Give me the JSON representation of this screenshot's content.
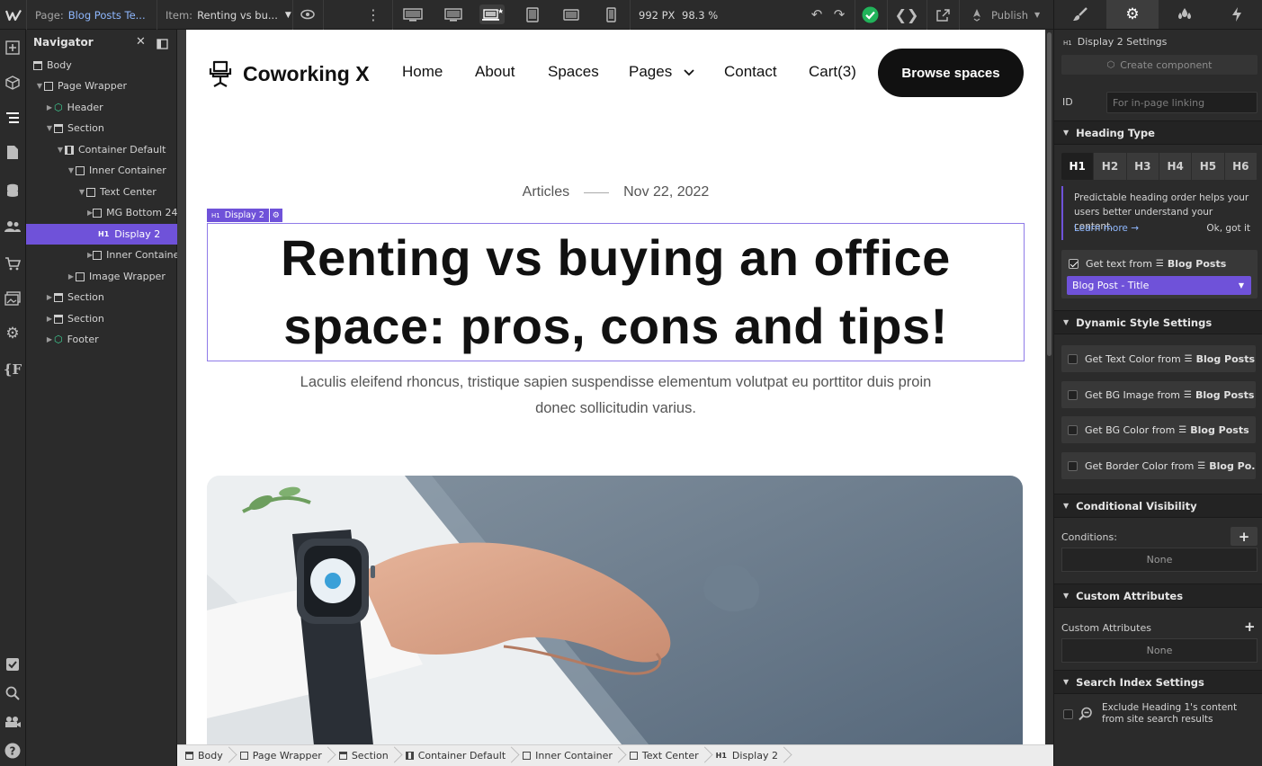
{
  "toolbar": {
    "page_label": "Page:",
    "page_name": "Blog Posts Te...",
    "item_label": "Item:",
    "item_name": "Renting vs bu...",
    "width_px": "992 PX",
    "zoom": "98.3 %",
    "publish_label": "Publish"
  },
  "navigator": {
    "title": "Navigator",
    "items": [
      {
        "label": "Body"
      },
      {
        "label": "Page Wrapper"
      },
      {
        "label": "Header"
      },
      {
        "label": "Section"
      },
      {
        "label": "Container Default"
      },
      {
        "label": "Inner Container"
      },
      {
        "label": "Text Center"
      },
      {
        "label": "MG Bottom 24"
      },
      {
        "label": "Display 2"
      },
      {
        "label": "Inner Containe"
      },
      {
        "label": "Image Wrapper"
      },
      {
        "label": "Section"
      },
      {
        "label": "Section"
      },
      {
        "label": "Footer"
      }
    ]
  },
  "site": {
    "logo_text": "Coworking X",
    "menu": [
      "Home",
      "About",
      "Spaces",
      "Pages",
      "Contact",
      "Cart(3)"
    ],
    "cta": "Browse spaces",
    "article": {
      "category": "Articles",
      "date": "Nov 22, 2022",
      "selection_tag": "Display 2",
      "selection_tag_prefix": "H1",
      "title": "Renting vs buying an office space: pros, cons and tips!",
      "summary": "Laculis eleifend rhoncus, tristique sapien suspendisse elementum volutpat eu porttitor duis proin donec sollicitudin varius."
    }
  },
  "breadcrumbs": [
    {
      "label": "Body",
      "icon": "body-icon"
    },
    {
      "label": "Page Wrapper",
      "icon": "box-icon"
    },
    {
      "label": "Section",
      "icon": "section-icon"
    },
    {
      "label": "Container Default",
      "icon": "container-icon"
    },
    {
      "label": "Inner Container",
      "icon": "box-icon"
    },
    {
      "label": "Text Center",
      "icon": "box-icon"
    },
    {
      "label": "Display 2",
      "icon": "h1-icon"
    }
  ],
  "panel": {
    "element_prefix": "H1",
    "element_title": "Display 2 Settings",
    "create_component": "Create component",
    "id_label": "ID",
    "id_placeholder": "For in-page linking",
    "heading_type": {
      "title": "Heading Type",
      "options": [
        "H1",
        "H2",
        "H3",
        "H4",
        "H5",
        "H6"
      ],
      "selected": "H1",
      "hint": "Predictable heading order helps your users better understand your content.",
      "learn_more": "Learn more →",
      "ok": "Ok, got it",
      "get_text_prefix": "Get text from",
      "get_text_source": "Blog Posts",
      "get_text_field": "Blog Post - Title"
    },
    "dynamic_style": {
      "title": "Dynamic Style Settings",
      "rows": [
        {
          "label": "Get Text Color from",
          "source": "Blog Posts"
        },
        {
          "label": "Get BG Image from",
          "source": "Blog Posts"
        },
        {
          "label": "Get BG Color from",
          "source": "Blog Posts"
        },
        {
          "label": "Get Border Color from",
          "source": "Blog Po..."
        }
      ]
    },
    "conditional_visibility": {
      "title": "Conditional Visibility",
      "conditions_label": "Conditions:",
      "value": "None"
    },
    "custom_attributes": {
      "title": "Custom Attributes",
      "label": "Custom Attributes",
      "value": "None"
    },
    "search_index": {
      "title": "Search Index Settings",
      "exclude_line1": "Exclude Heading 1's content",
      "exclude_line2": "from site search results"
    }
  },
  "colors": {
    "accent": "#6f52d9",
    "status_green": "#21b35a",
    "panel_bg": "#2b2b2b",
    "cta_bg": "#111111"
  }
}
